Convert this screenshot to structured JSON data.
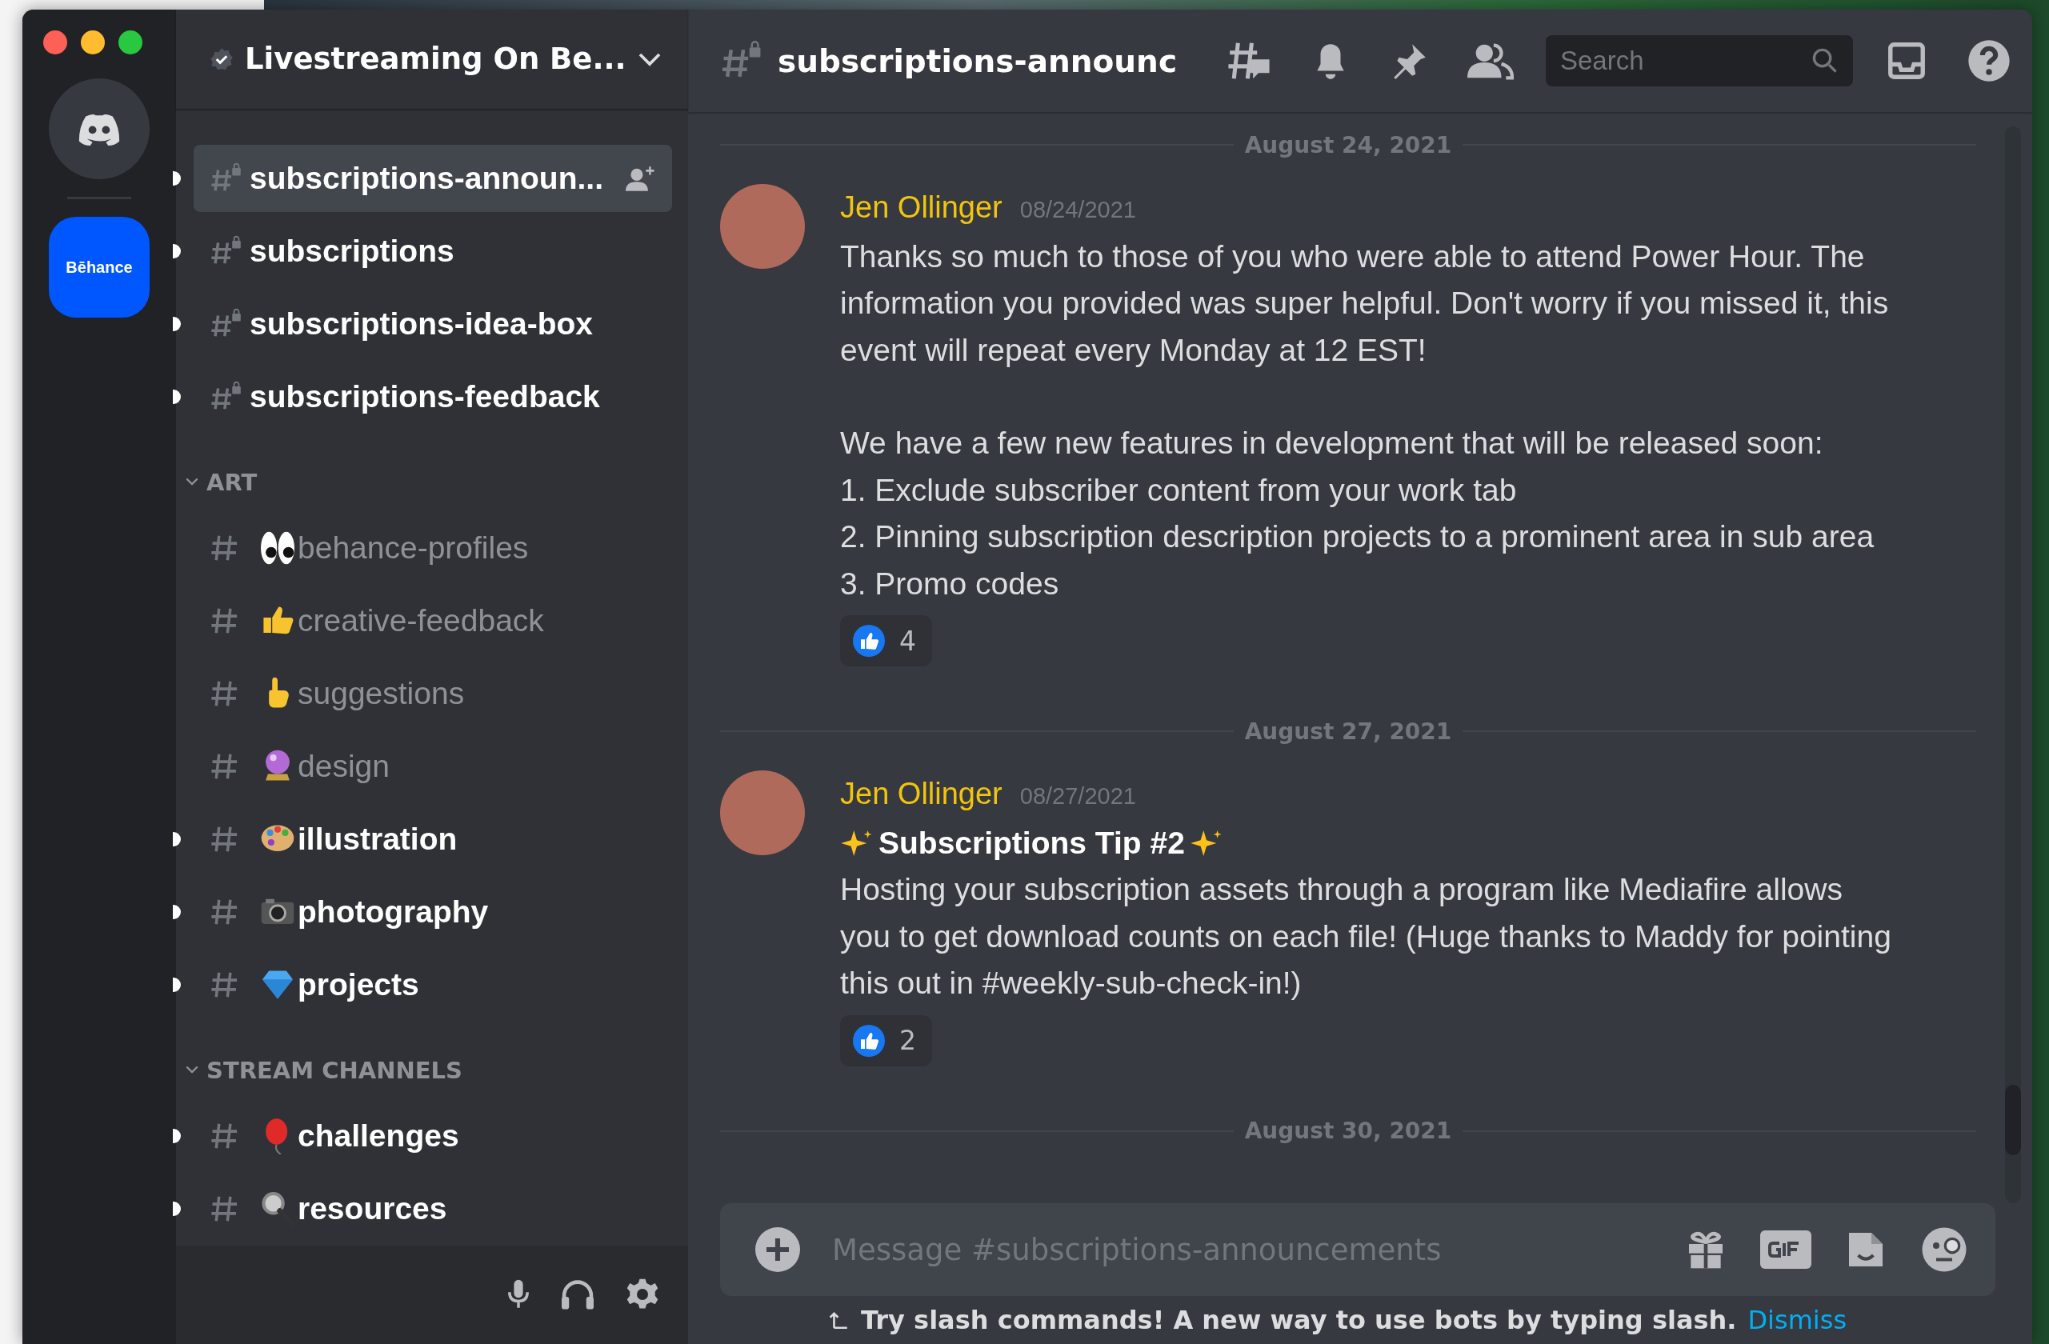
{
  "window": {
    "server_name": "Livestreaming On Be..."
  },
  "servers": [
    {
      "kind": "home",
      "selected": false
    },
    {
      "kind": "behance",
      "label": "Bēhance",
      "selected": true
    }
  ],
  "sidebar": {
    "sections": [
      {
        "channels": [
          {
            "name": "subscriptions-announ...",
            "locked": true,
            "unread": true,
            "selected": true,
            "invite": true
          },
          {
            "name": "subscriptions",
            "locked": true,
            "unread": true,
            "selected": false
          },
          {
            "name": "subscriptions-idea-box",
            "locked": true,
            "unread": true,
            "selected": false
          },
          {
            "name": "subscriptions-feedback",
            "locked": true,
            "unread": true,
            "selected": false
          }
        ]
      },
      {
        "title": "ART",
        "expanded": true,
        "channels": [
          {
            "name": "behance-profiles",
            "locked": false,
            "unread": false,
            "selected": false
          },
          {
            "name": "creative-feedback",
            "locked": false,
            "unread": false,
            "selected": false
          },
          {
            "name": "suggestions",
            "locked": false,
            "unread": false,
            "selected": false
          },
          {
            "name": "design",
            "locked": false,
            "unread": false,
            "selected": false
          },
          {
            "name": "illustration",
            "locked": false,
            "unread": true,
            "selected": false
          },
          {
            "name": "photography",
            "locked": false,
            "unread": true,
            "selected": false
          },
          {
            "name": "projects",
            "locked": false,
            "unread": true,
            "selected": false
          }
        ]
      },
      {
        "title": "STREAM CHANNELS",
        "expanded": true,
        "channels": [
          {
            "name": "challenges",
            "locked": false,
            "unread": true,
            "selected": false
          },
          {
            "name": "resources",
            "locked": false,
            "unread": true,
            "selected": false
          }
        ]
      }
    ]
  },
  "header": {
    "channel": "subscriptions-announc",
    "search": {
      "placeholder": "Search"
    }
  },
  "messages": [
    {
      "kind": "divider",
      "text": "August 24, 2021"
    },
    {
      "kind": "message",
      "author": "Jen Ollinger",
      "time": "08/24/2021",
      "paragraphs": [
        [
          "Thanks so much to those of you who were able to attend Power Hour. The information you provided was super helpful. Don't worry if you missed it, this event will repeat every Monday at 12 EST!"
        ],
        [
          "We have a few new features in development that will be released soon:",
          "1. Exclude subscriber content from your work tab",
          "2. Pinning subscription description projects to a prominent area in sub area",
          "3. Promo codes"
        ]
      ],
      "reaction": "4"
    },
    {
      "kind": "divider",
      "text": "August 27, 2021"
    },
    {
      "kind": "message",
      "author": "Jen Ollinger",
      "time": "08/27/2021",
      "title": "Subscriptions Tip #2",
      "paragraphs": [
        [
          "Hosting your subscription assets through a program like Mediafire allows you to get download counts on each file! (Huge thanks to Maddy for pointing this out in #weekly-sub-check-in!)"
        ]
      ],
      "reaction": "2"
    },
    {
      "kind": "divider",
      "text": "August 30, 2021"
    }
  ],
  "composer": {
    "placeholder": "Message #subscriptions-announcements"
  },
  "hint": {
    "text": "Try slash commands! A new way to use bots by typing slash.",
    "link": "Dismiss"
  }
}
